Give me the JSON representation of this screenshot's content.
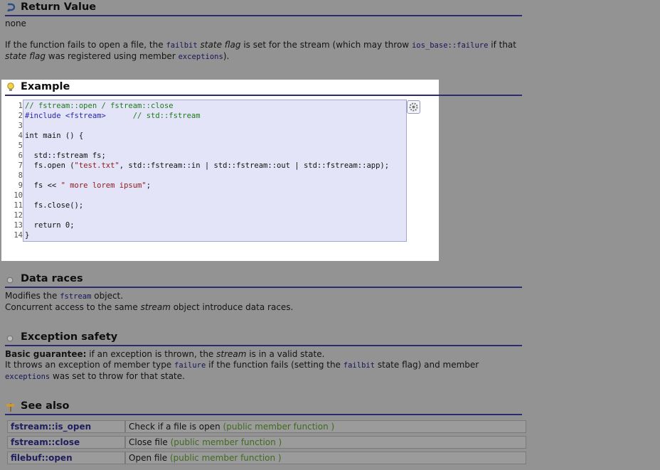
{
  "return_value": {
    "heading": "Return Value",
    "none": "none",
    "p1": "If the function fails to open a file, the",
    "failbit": "failbit",
    "state_flag": "state flag",
    "p2": "is set for the stream (which may throw",
    "ios_failure": "ios_base::failure",
    "p3": "if that",
    "state_flag_2": "state flag",
    "p4": "was registered using member",
    "exceptions": "exceptions",
    "p5": ")."
  },
  "example": {
    "heading": "Example",
    "line_numbers": "1\n2\n3\n4\n5\n6\n7\n8\n9\n10\n11\n12\n13\n14",
    "code": {
      "l1": "// fstream::open / fstream::close",
      "l2a": "#include <fstream>",
      "l2b": "      // std::fstream",
      "l4": "int main () {",
      "l6": "  std::fstream fs;",
      "l7a": "  fs.open (",
      "l7b": "\"test.txt\"",
      "l7c": ", std::fstream::in | std::fstream::out | std::fstream::app);",
      "l9a": "  fs << ",
      "l9b": "\" more lorem ipsum\"",
      "l9c": ";",
      "l11": "  fs.close();",
      "l13": "  return 0;",
      "l14": "}"
    }
  },
  "data_races": {
    "heading": "Data races",
    "line1a": "Modifies the",
    "fstream": "fstream",
    "line1b": "object.",
    "line2a": "Concurrent access to the same",
    "stream": "stream",
    "line2b": "object introduce data races."
  },
  "exception_safety": {
    "heading": "Exception safety",
    "basic": "Basic guarantee:",
    "l1a": "if an exception is thrown, the",
    "stream": "stream",
    "l1b": "is in a valid state.",
    "l2a": "It throws an exception of member type",
    "failure": "failure",
    "l2b": "if the function fails (setting the",
    "failbit": "failbit",
    "l2c": "state flag) and member",
    "exceptions": "exceptions",
    "l3": "was set to throw for that state."
  },
  "see_also": {
    "heading": "See also",
    "rows": [
      {
        "name": "fstream::is_open",
        "desc": "Check if a file is open",
        "kind": "(public member function )"
      },
      {
        "name": "fstream::close",
        "desc": "Close file",
        "kind": "(public member function )"
      },
      {
        "name": "filebuf::open",
        "desc": "Open file",
        "kind": "(public member function )"
      }
    ]
  }
}
